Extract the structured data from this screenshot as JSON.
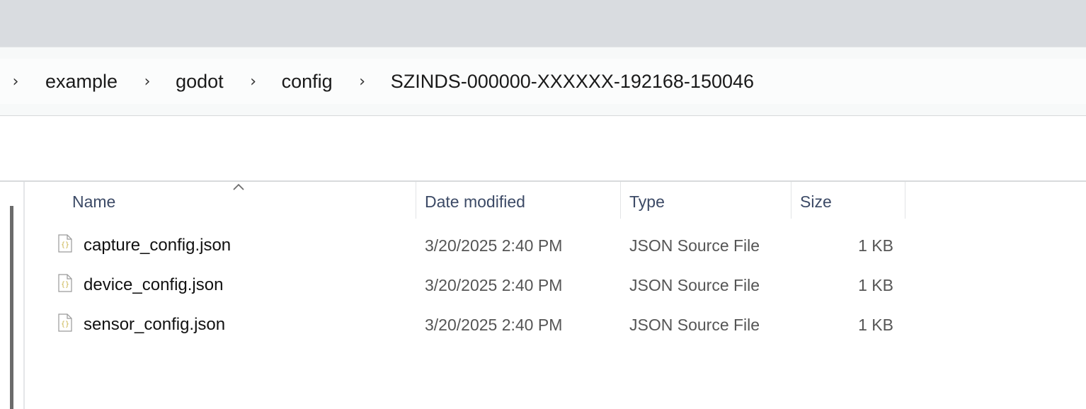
{
  "breadcrumb": {
    "items": [
      "example",
      "godot",
      "config",
      "SZINDS-000000-XXXXXX-192168-150046"
    ]
  },
  "columns": {
    "name": "Name",
    "date": "Date modified",
    "type": "Type",
    "size": "Size"
  },
  "files": [
    {
      "name": "capture_config.json",
      "date": "3/20/2025 2:40 PM",
      "type": "JSON Source File",
      "size": "1 KB",
      "icon": "json-file-icon"
    },
    {
      "name": "device_config.json",
      "date": "3/20/2025 2:40 PM",
      "type": "JSON Source File",
      "size": "1 KB",
      "icon": "json-file-icon"
    },
    {
      "name": "sensor_config.json",
      "date": "3/20/2025 2:40 PM",
      "type": "JSON Source File",
      "size": "1 KB",
      "icon": "json-file-icon"
    }
  ],
  "colors": {
    "titlebar": "#d9dce0",
    "column_header_text": "#3c4a66",
    "json_icon_accent": "#c9b34a"
  }
}
